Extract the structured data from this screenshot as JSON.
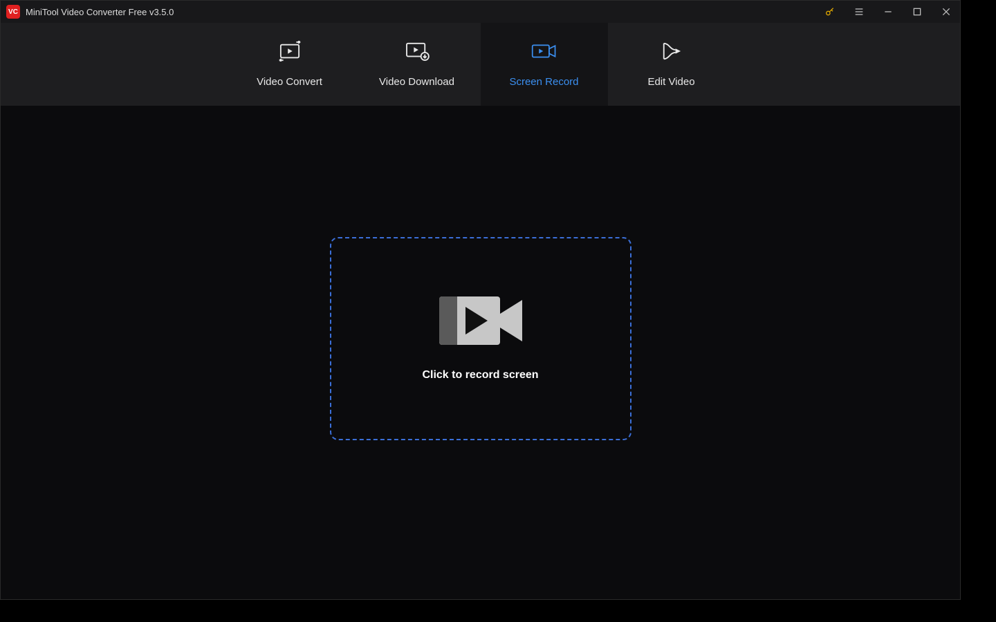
{
  "titlebar": {
    "app_logo_text": "VC",
    "title": "MiniTool Video Converter Free v3.5.0"
  },
  "tabs": [
    {
      "label": "Video Convert"
    },
    {
      "label": "Video Download"
    },
    {
      "label": "Screen Record"
    },
    {
      "label": "Edit Video"
    }
  ],
  "main": {
    "drop_prompt": "Click to record screen"
  },
  "colors": {
    "accent": "#3b8ff0",
    "dashed_border": "#3b6fd8"
  }
}
